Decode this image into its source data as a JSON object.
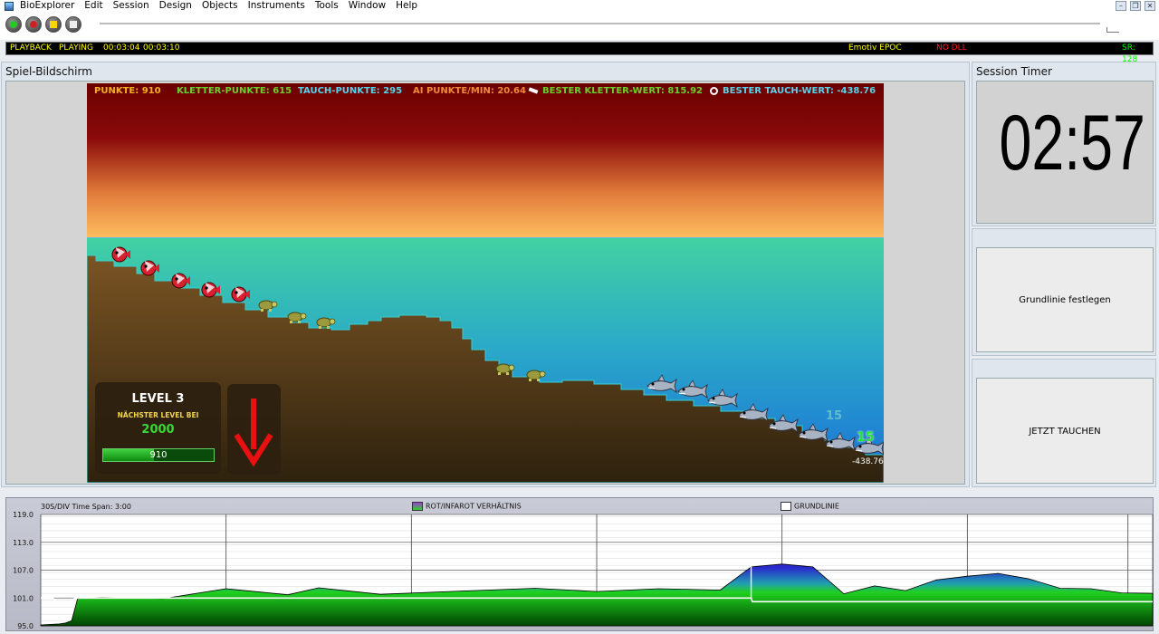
{
  "app": {
    "title": "BioExplorer",
    "menu": [
      "BioExplorer",
      "Edit",
      "Session",
      "Design",
      "Objects",
      "Instruments",
      "Tools",
      "Window",
      "Help"
    ]
  },
  "status": {
    "mode": "PLAYBACK",
    "state": "PLAYING",
    "elapsed": "00:03:04",
    "total": "00:03:10",
    "device": "Emotiv EPOC",
    "dll": "NO DLL",
    "sample_rate": "SR: 128"
  },
  "game_panel": {
    "title": "Spiel-Bildschirm",
    "hud": {
      "punkte": "PUNKTE: 910",
      "kletter": "KLETTER-PUNKTE: 615",
      "tauch": "TAUCH-PUNKTE: 295",
      "ai": "AI PUNKTE/MIN: 20.64",
      "best_kletter": "BESTER KLETTER-WERT: 815.92",
      "best_tauch": "BESTER TAUCH-WERT: -438.76"
    },
    "level": {
      "title": "LEVEL 3",
      "next_label": "NÄCHSTER LEVEL BEI",
      "next_value": "2000",
      "progress_text": "910",
      "progress_fraction": 0.455
    },
    "depth_value": "-438.76",
    "float_numbers": [
      "15",
      "15"
    ],
    "colors": {
      "sky_top": "#7a0000",
      "sky_bottom": "#ffbb55",
      "water_top": "#3fcf9f",
      "water_bottom": "#1e8bd6",
      "ground": "#6b4a22"
    }
  },
  "session_timer": {
    "title": "Session Timer",
    "time": "02:57"
  },
  "buttons": {
    "baseline": "Grundlinie festlegen",
    "dive": "JETZT TAUCHEN"
  },
  "chart_data": {
    "type": "area",
    "header_left": "30S/DIV   Time Span: 3:00",
    "legend": [
      {
        "name": "ROT/INFAROT VERHÄLTNIS",
        "color": "#8844cc"
      },
      {
        "name": "GRUNDLINIE",
        "color": "#ffffff"
      }
    ],
    "ylim": [
      95.0,
      119.0
    ],
    "yticks": [
      "119.0",
      "113.0",
      "107.0",
      "101.0",
      "95.0"
    ],
    "x_span_seconds": 180,
    "series": [
      {
        "name": "ROT/INFAROT VERHÄLTNIS",
        "x": [
          0,
          3,
          4,
          5,
          6,
          10,
          20,
          30,
          40,
          45,
          55,
          70,
          80,
          90,
          100,
          110,
          115,
          120,
          125,
          130,
          135,
          140,
          145,
          150,
          155,
          160,
          165,
          170,
          175,
          180
        ],
        "values": [
          95.2,
          95.4,
          95.6,
          96.1,
          101.0,
          101.1,
          100.9,
          103.0,
          101.7,
          103.2,
          101.8,
          102.6,
          103.1,
          102.4,
          103.0,
          102.7,
          107.7,
          108.3,
          107.7,
          101.9,
          103.6,
          102.6,
          104.9,
          105.7,
          106.3,
          105.1,
          103.1,
          103.0,
          102.1,
          102.0
        ]
      },
      {
        "name": "GRUNDLINIE",
        "x": [
          0,
          2,
          2.5,
          5,
          5.5,
          115,
          115.2,
          180
        ],
        "values": [
          101.0,
          101.0,
          100.2,
          100.2,
          101.0,
          101.0,
          100.2,
          100.2
        ]
      }
    ],
    "grid": true,
    "legend_position": "top"
  }
}
